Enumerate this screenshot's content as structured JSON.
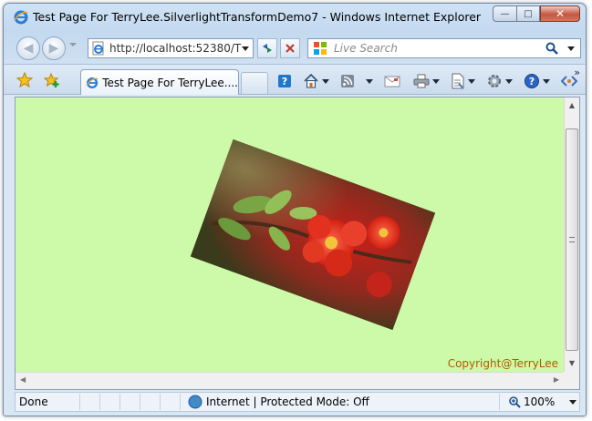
{
  "window": {
    "title": "Test Page For TerryLee.SilverlightTransformDemo7 - Windows Internet Explorer",
    "caption_buttons": {
      "minimize": "—",
      "maximize": "□",
      "close": "✕"
    }
  },
  "navigation": {
    "address": "http://localhost:52380/T",
    "search_placeholder": "Live Search",
    "back_glyph": "◀",
    "forward_glyph": "▶"
  },
  "tabs": [
    {
      "label": "Test Page For TerryLee....",
      "active": true
    }
  ],
  "command_bar": {
    "items": [
      "help-topic-icon",
      "home-icon",
      "feeds-icon",
      "read-mail-icon",
      "print-icon",
      "page-icon",
      "tools-icon",
      "help-icon",
      "research-icon"
    ],
    "more_glyph": "»"
  },
  "content": {
    "background": "#ccfaa8",
    "image_description_rotation_deg": 20,
    "copyright": "Copyright@TerryLee"
  },
  "statusbar": {
    "status": "Done",
    "zone": "Internet | Protected Mode: Off",
    "zoom": "100%"
  }
}
